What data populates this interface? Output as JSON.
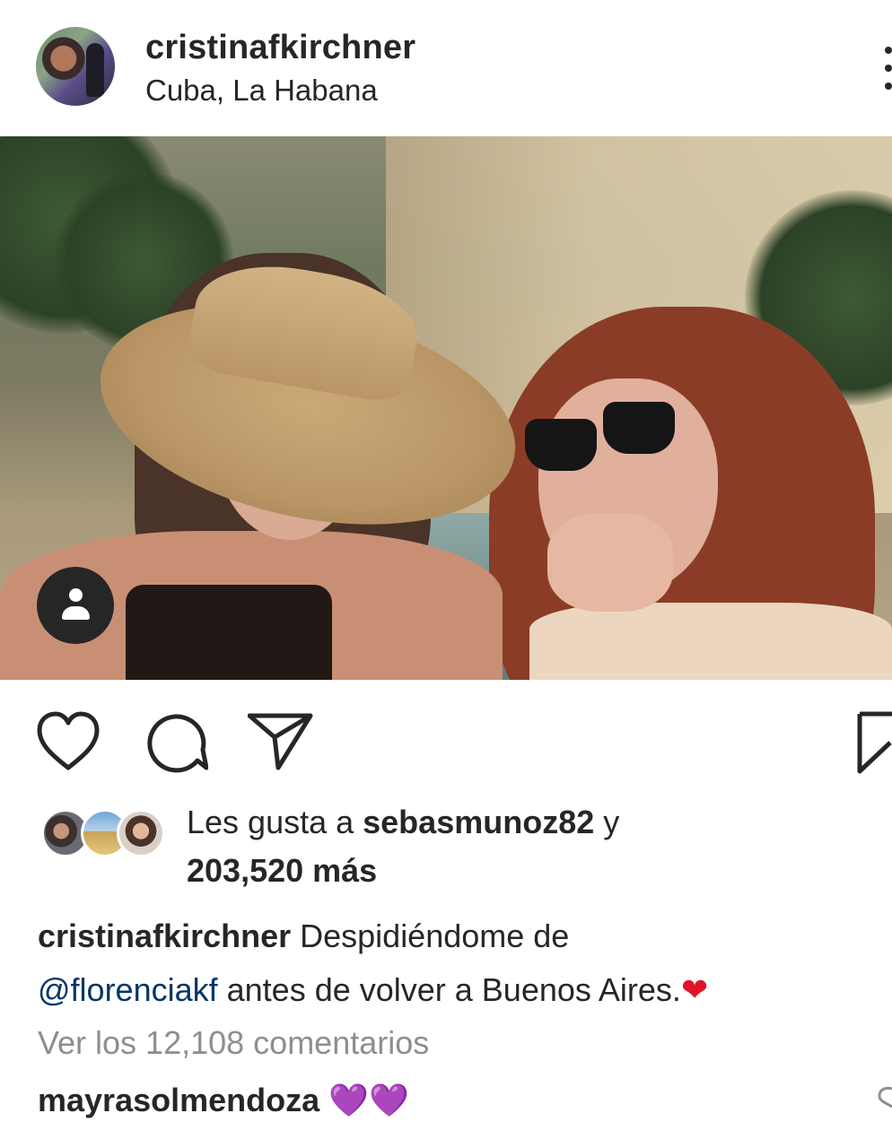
{
  "post": {
    "username": "cristinafkirchner",
    "location": "Cuba, La Habana"
  },
  "icons": {
    "more": "more-vertical-icon",
    "tag": "user-tag-icon",
    "like": "heart-outline-icon",
    "comment": "comment-bubble-icon",
    "share": "send-paper-plane-icon",
    "save": "bookmark-icon"
  },
  "likes": {
    "prefix": "Les gusta a ",
    "user": "sebasmunoz82",
    "connector": " y",
    "count": "203,520 más"
  },
  "caption": {
    "user": "cristinafkirchner",
    "text1": " Despidiéndome de",
    "mention": "@florenciakf",
    "text2": " antes de volver a Buenos Aires.",
    "emoji": "❤"
  },
  "comments": {
    "view_all": "Ver los 12,108 comentarios",
    "first_user": "mayrasolmendoza",
    "first_text": "💜💜"
  },
  "colors": {
    "text": "#262626",
    "secondary": "#8e8e8e",
    "link": "#003569",
    "purple_heart": "#a13ae5",
    "red_heart": "#e0132b"
  }
}
